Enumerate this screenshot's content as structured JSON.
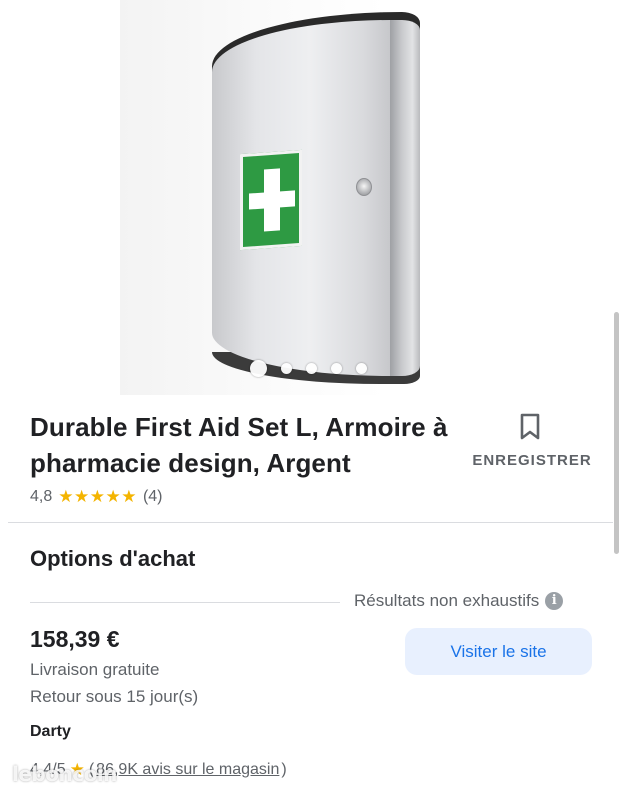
{
  "product": {
    "title": "Durable First Aid Set L, Armoire à pharmacie design, Argent",
    "image_dots_count": 5,
    "active_dot": 1,
    "save_label": "ENREGISTRER",
    "rating_value": "4,8",
    "rating_stars": "★★★★★",
    "rating_count": "(4)"
  },
  "purchase": {
    "section_title": "Options d'achat",
    "results_note": "Résultats non exhaustifs",
    "info_icon": "i",
    "price": "158,39 €",
    "shipping": "Livraison gratuite",
    "returns": "Retour sous 15 jour(s)",
    "visit_label": "Visiter le site",
    "merchant": "Darty",
    "store_rating": "4,4/5",
    "store_star": "★",
    "reviews_open": "(",
    "reviews": "86,9K avis sur le magasin",
    "reviews_close": ")"
  },
  "watermark": "leboncoin",
  "colors": {
    "accent": "#1a73e8",
    "button_bg": "#e8f0fe",
    "star": "#f4b400",
    "first_aid_green": "#2e9a43"
  }
}
